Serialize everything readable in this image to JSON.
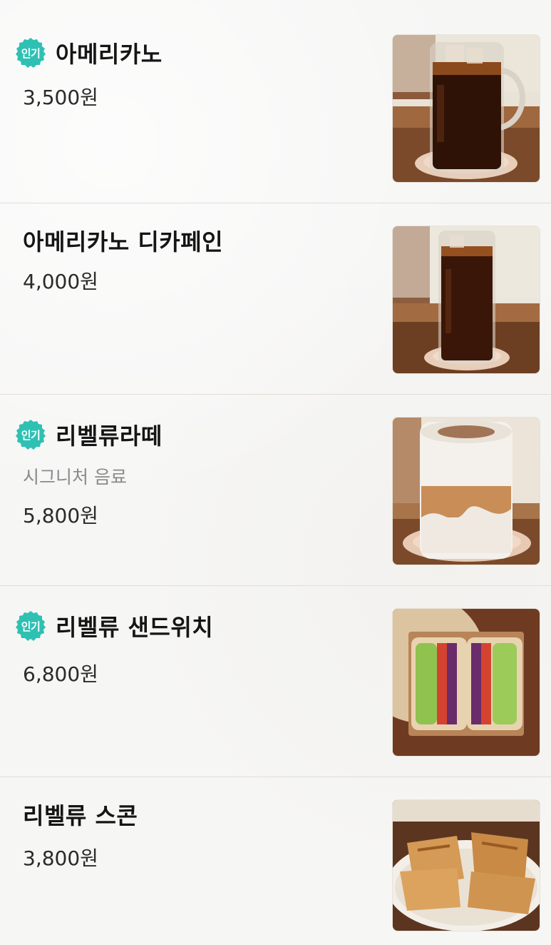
{
  "badge_label": "인기",
  "colors": {
    "badge": "#2ec1b3",
    "name": "#151515",
    "price": "#2a2a2a",
    "desc": "#8a8a8a",
    "divider": "#e3ddd2"
  },
  "items": [
    {
      "name": "아메리카노",
      "price": "3,500원",
      "popular": true,
      "image": "iced-americano-mug-photo"
    },
    {
      "name": "아메리카노 디카페인",
      "price": "4,000원",
      "popular": false,
      "image": "iced-decaf-americano-glass-photo"
    },
    {
      "name": "리벨류라떼",
      "description": "시그니처 음료",
      "price": "5,800원",
      "popular": true,
      "image": "cream-latte-glass-photo"
    },
    {
      "name": "리벨류 샌드위치",
      "price": "6,800원",
      "popular": true,
      "image": "sandwich-box-photo"
    },
    {
      "name": "리벨류 스콘",
      "price": "3,800원",
      "popular": false,
      "image": "scones-plate-photo"
    }
  ]
}
